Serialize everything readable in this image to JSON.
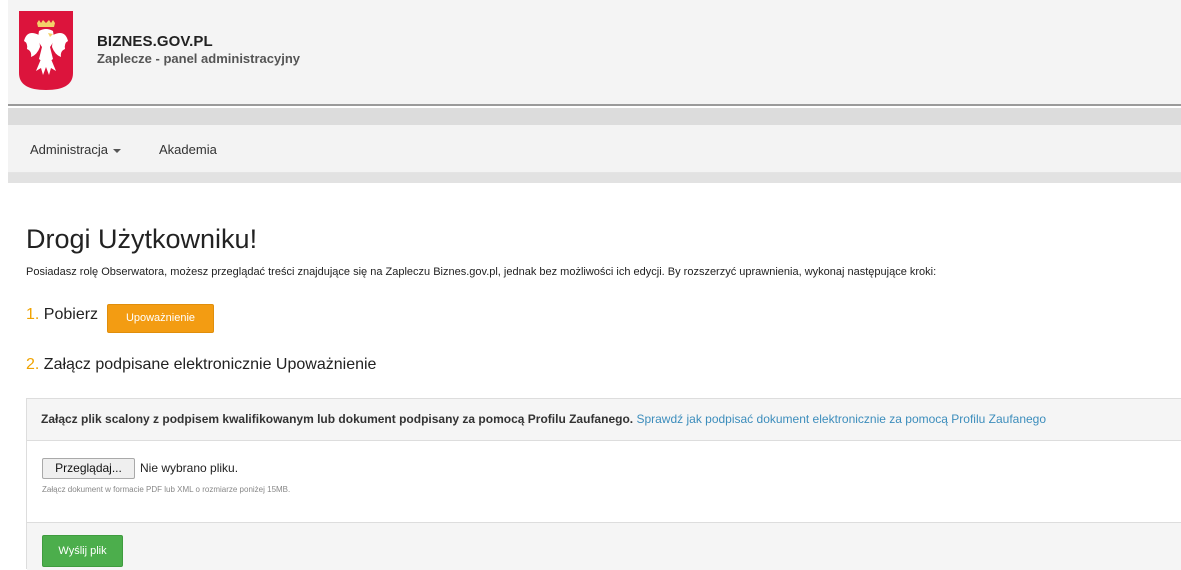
{
  "header": {
    "title": "BIZNES.GOV.PL",
    "subtitle": "Zaplecze - panel administracyjny"
  },
  "nav": {
    "items": [
      {
        "label": "Administracja",
        "dropdown": true
      },
      {
        "label": "Akademia",
        "dropdown": false
      }
    ]
  },
  "main": {
    "heading": "Drogi Użytkowniku!",
    "intro": "Posiadasz rolę Obserwatora, możesz przeglądać treści znajdujące się na Zapleczu Biznes.gov.pl, jednak bez możliwości ich edycji. By rozszerzyć uprawnienia, wykonaj następujące kroki:",
    "step1": {
      "number": "1.",
      "text": "Pobierz",
      "button_label": "Upoważnienie"
    },
    "step2": {
      "number": "2.",
      "text": "Załącz podpisane elektronicznie Upoważnienie"
    }
  },
  "upload_panel": {
    "heading": "Załącz plik scalony z podpisem kwalifikowanym lub dokument podpisany za pomocą Profilu Zaufanego.",
    "link_text": "Sprawdź jak podpisać dokument elektronicznie za pomocą Profilu Zaufanego",
    "browse_label": "Przeglądaj...",
    "file_status": "Nie wybrano pliku.",
    "help_text": "Załącz dokument w formacie PDF lub XML o rozmiarze poniżej 15MB.",
    "submit_label": "Wyślij plik"
  },
  "colors": {
    "accent_orange": "#f39c12",
    "success_green": "#4cae4c",
    "link_blue": "#3c8dbc",
    "emblem_red": "#dc143c"
  }
}
